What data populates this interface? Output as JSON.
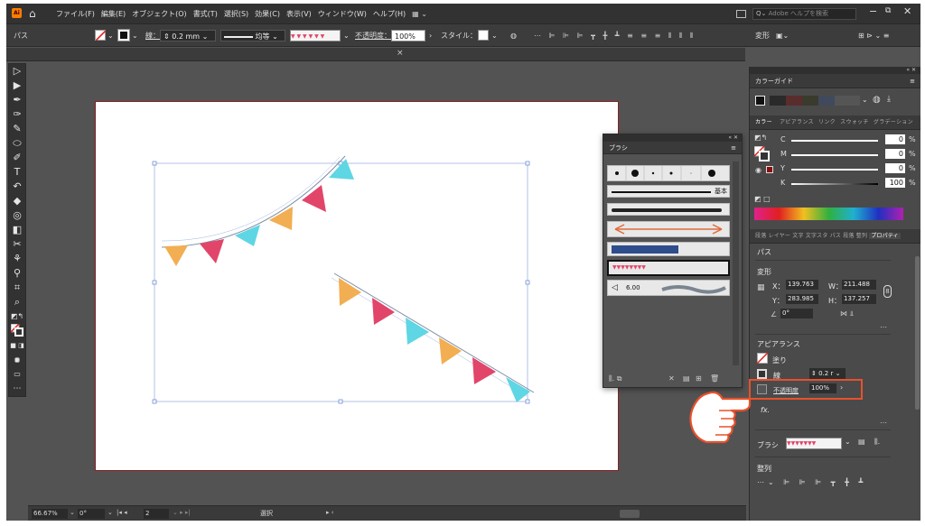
{
  "menubar": {
    "items": [
      "ファイル(F)",
      "編集(E)",
      "オブジェクト(O)",
      "書式(T)",
      "選択(S)",
      "効果(C)",
      "表示(V)",
      "ウィンドウ(W)",
      "ヘルプ(H)"
    ],
    "search_placeholder": "Adobe ヘルプを検索"
  },
  "control": {
    "object_type": "パス",
    "stroke_label": "線：",
    "stroke_value": "0.2 mm",
    "profile_label": "均等",
    "opacity_label": "不透明度：",
    "opacity_value": "100%",
    "style_label": "スタイル："
  },
  "tab": {
    "close": "×"
  },
  "status": {
    "zoom": "66.67%",
    "rotation": "0°",
    "artboard": "2",
    "mode": "選択"
  },
  "color_guide": {
    "title": "カラーガイド"
  },
  "color_panel": {
    "tabs": [
      "カラー",
      "アピアランス",
      "リンク",
      "スウォッチ",
      "グラデーション"
    ],
    "channels": [
      {
        "label": "C",
        "value": "0",
        "unit": "%"
      },
      {
        "label": "M",
        "value": "0",
        "unit": "%"
      },
      {
        "label": "Y",
        "value": "0",
        "unit": "%"
      },
      {
        "label": "K",
        "value": "100",
        "unit": "%"
      }
    ]
  },
  "props_tabs": [
    "段落",
    "レイヤー",
    "文字",
    "文字スタ",
    "パス",
    "段落",
    "整列",
    "プロパティ"
  ],
  "properties": {
    "title": "パス",
    "transform": "変形",
    "x_label": "X：",
    "x_value": "139.763",
    "y_label": "Y：",
    "y_value": "283.985",
    "w_label": "W：",
    "w_value": "211.488",
    "h_label": "H：",
    "h_value": "137.257",
    "angle_value": "0°",
    "appearance": "アピアランス",
    "fill_label": "塗り",
    "stroke_label": "線",
    "stroke_value": "0.2 r",
    "opacity_label": "不透明度",
    "opacity_value": "100%",
    "fx_label": "fx.",
    "brush_label": "ブラシ",
    "align_label": "整列"
  },
  "brush_panel": {
    "title": "ブラシ",
    "basic_label": "基本",
    "size_value": "6.00"
  },
  "colors": {
    "accent_red": "#e2456a",
    "bunting_orange": "#f2ae52",
    "bunting_pink": "#e2456a",
    "bunting_cyan": "#5fd6e3",
    "callout": "#e8512b"
  }
}
